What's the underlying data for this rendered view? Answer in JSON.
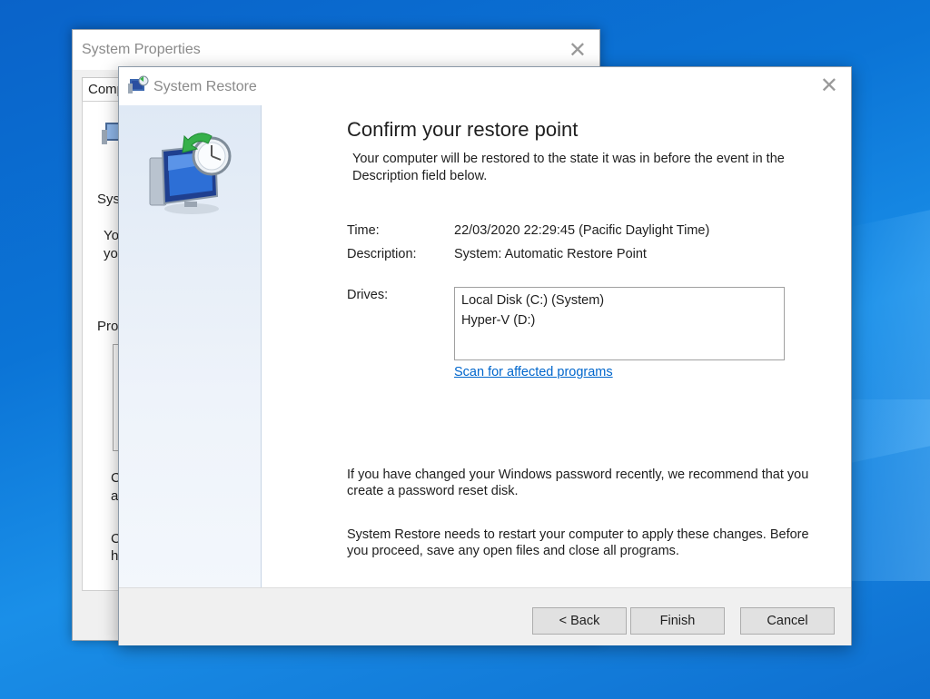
{
  "background_window": {
    "title": "System Properties",
    "tab_label": "Comp",
    "fragments": [
      "Sys",
      "Yo",
      "yo",
      "Pro",
      "C",
      "a",
      "C",
      "h"
    ]
  },
  "dialog": {
    "title": "System Restore",
    "heading": "Confirm your restore point",
    "intro": "Your computer will be restored to the state it was in before the event in the Description field below.",
    "time_label": "Time:",
    "time_value": "22/03/2020 22:29:45 (Pacific Daylight Time)",
    "description_label": "Description:",
    "description_value": "System: Automatic Restore Point",
    "drives_label": "Drives:",
    "drives": [
      "Local Disk (C:) (System)",
      "Hyper-V (D:)"
    ],
    "scan_link": "Scan for affected programs",
    "password_note": "If you have changed your Windows password recently, we recommend that you create a password reset disk.",
    "restart_note": "System Restore needs to restart your computer to apply these changes. Before you proceed, save any open files and close all programs.",
    "buttons": {
      "back": "< Back",
      "finish": "Finish",
      "cancel": "Cancel"
    }
  },
  "icons": {
    "close": "close-icon",
    "app": "system-restore-icon",
    "monitor_clock": "monitor-clock-restore-icon"
  },
  "colors": {
    "desktop": "#0b74d6",
    "link": "#0066cc",
    "sidebar": "#e4edf7"
  }
}
